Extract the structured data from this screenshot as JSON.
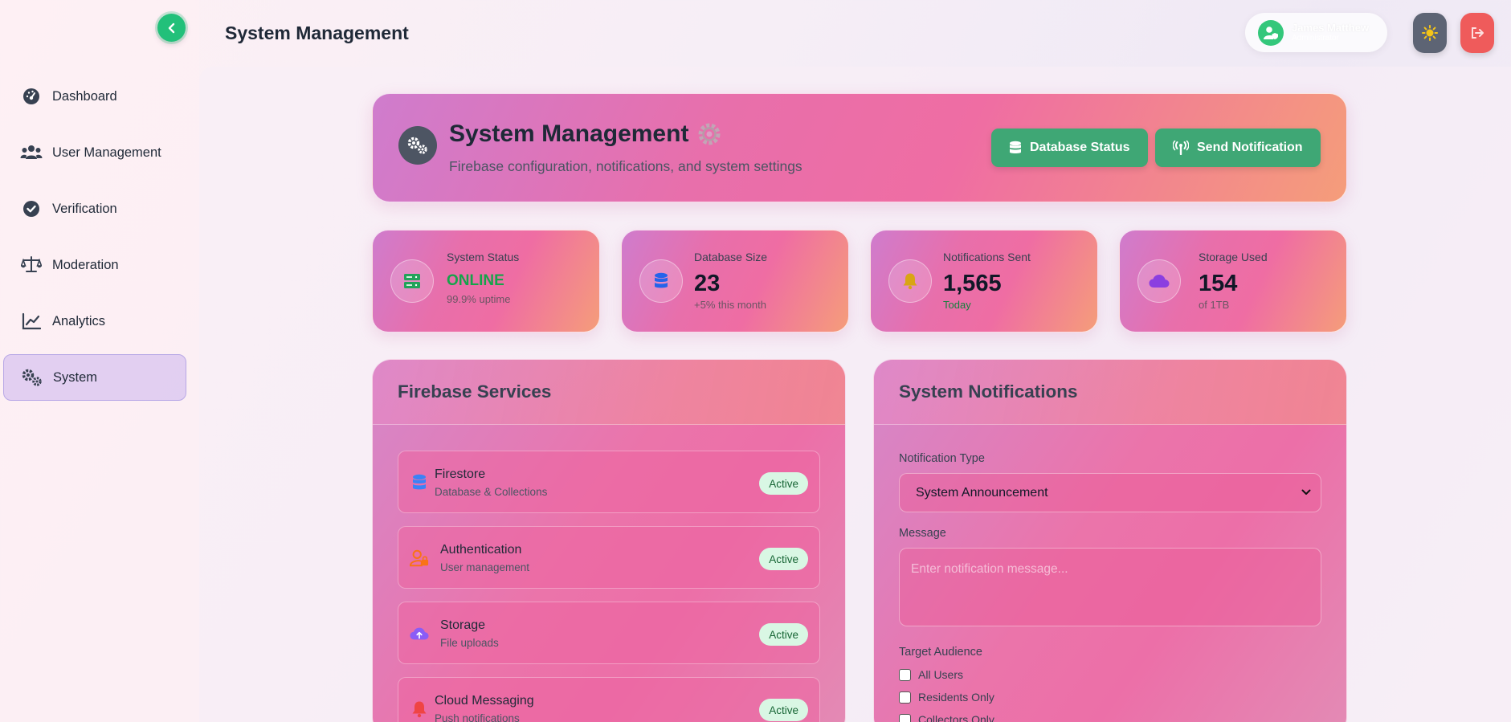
{
  "topbar": {
    "page_title": "System Management",
    "user_name": "James Matthew",
    "user_role": "Administrator"
  },
  "sidebar": {
    "items": [
      {
        "label": "Dashboard",
        "icon": "gauge-icon"
      },
      {
        "label": "User Management",
        "icon": "users-icon"
      },
      {
        "label": "Verification",
        "icon": "check-circle-icon"
      },
      {
        "label": "Moderation",
        "icon": "scale-icon"
      },
      {
        "label": "Analytics",
        "icon": "chart-line-icon"
      },
      {
        "label": "System",
        "icon": "cogs-icon",
        "active": true
      }
    ]
  },
  "header": {
    "title": "System Management",
    "subtitle": "Firebase configuration, notifications, and system settings",
    "db_button": "Database Status",
    "notify_button": "Send Notification"
  },
  "stats": [
    {
      "label": "System Status",
      "value": "ONLINE",
      "note": "99.9% uptime",
      "icon": "server-icon",
      "icon_color": "#22a35a"
    },
    {
      "label": "Database Size",
      "value": "23",
      "note": "+5% this month",
      "icon": "database-icon",
      "icon_color": "#2563eb"
    },
    {
      "label": "Notifications Sent",
      "value": "1,565",
      "note": "Today",
      "icon": "bell-icon",
      "icon_color": "#d9a514"
    },
    {
      "label": "Storage Used",
      "value": "154",
      "note": "of 1TB",
      "icon": "cloud-icon",
      "icon_color": "#8b3fe0"
    }
  ],
  "firebase": {
    "title": "Firebase Services",
    "services": [
      {
        "name": "Firestore",
        "desc": "Database & Collections",
        "status": "Active",
        "icon": "database-icon",
        "icon_color": "#3b82f6"
      },
      {
        "name": "Authentication",
        "desc": "User management",
        "status": "Active",
        "icon": "user-lock-icon",
        "icon_color": "#f97316"
      },
      {
        "name": "Storage",
        "desc": "File uploads",
        "status": "Active",
        "icon": "cloud-upload-icon",
        "icon_color": "#8b5cf6"
      },
      {
        "name": "Cloud Messaging",
        "desc": "Push notifications",
        "status": "Active",
        "icon": "bell-icon",
        "icon_color": "#ef4444"
      }
    ]
  },
  "notifications": {
    "title": "System Notifications",
    "type_label": "Notification Type",
    "type_value": "System Announcement",
    "message_label": "Message",
    "message_placeholder": "Enter notification message...",
    "audience_label": "Target Audience",
    "audience_options": [
      "All Users",
      "Residents Only",
      "Collectors Only"
    ]
  },
  "colors": {
    "accent_green": "#3fa775",
    "active_nav_bg": "#d8c4f0",
    "logout_red": "#ef5b5b"
  }
}
